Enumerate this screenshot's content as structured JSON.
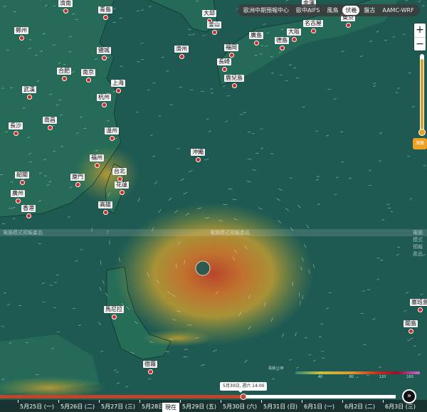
{
  "model_bar": {
    "items": [
      {
        "label": "歐洲中期預報中心",
        "active": false
      },
      {
        "label": "歐中AIFS",
        "active": false
      },
      {
        "label": "風鳥",
        "active": false
      },
      {
        "label": "伏羲",
        "active": true
      },
      {
        "label": "盤古",
        "active": false
      },
      {
        "label": "AAMC-WRF",
        "active": false
      }
    ]
  },
  "zoom": {
    "in_label": "+",
    "out_label": "−"
  },
  "layer_slider": {
    "label": "海面",
    "level_fraction": 0.95
  },
  "watermark": {
    "text": "電腦模式預報產品"
  },
  "legend": {
    "title": "風暴/小時",
    "ticks": [
      "40",
      "80",
      "120",
      "160"
    ]
  },
  "timeline": {
    "tooltip": "5月30日, 週六 14:00",
    "progress_fraction": 0.615,
    "days": [
      "5月25日 (一)",
      "5月26日 (二)",
      "5月27日 (三)",
      "5月28日 (四)",
      "5月29日 (五)",
      "5月30日 (六)",
      "5月31日 (日)",
      "6月1日 (一)",
      "6月2日 (二)",
      "6月3日 (三)"
    ],
    "now_label": "現在",
    "play_label": "»"
  },
  "cities": [
    {
      "name": "濟南"
    },
    {
      "name": "青島"
    },
    {
      "name": "大邱"
    },
    {
      "name": "金澤"
    },
    {
      "name": "東京"
    },
    {
      "name": "釜山"
    },
    {
      "name": "名古屋"
    },
    {
      "name": "鄭州"
    },
    {
      "name": "廣島"
    },
    {
      "name": "大阪"
    },
    {
      "name": "鹽城"
    },
    {
      "name": "濟州"
    },
    {
      "name": "福岡"
    },
    {
      "name": "德島"
    },
    {
      "name": "合肥"
    },
    {
      "name": "南京"
    },
    {
      "name": "長崎"
    },
    {
      "name": "上海"
    },
    {
      "name": "鹿兒島"
    },
    {
      "name": "武漢"
    },
    {
      "name": "杭州"
    },
    {
      "name": "長沙"
    },
    {
      "name": "南昌"
    },
    {
      "name": "溫州"
    },
    {
      "name": "沖繩"
    },
    {
      "name": "福州"
    },
    {
      "name": "台北"
    },
    {
      "name": "韶關"
    },
    {
      "name": "廈門"
    },
    {
      "name": "花蓮"
    },
    {
      "name": "廣州"
    },
    {
      "name": "香港"
    },
    {
      "name": "高雄"
    },
    {
      "name": "馬尼拉"
    },
    {
      "name": "塞班島"
    },
    {
      "name": "關島"
    },
    {
      "name": "宿霧"
    }
  ],
  "colors": {
    "ocean": "#1f5a52",
    "land": "#2c7a5d",
    "storm_core": "#c0442a",
    "storm_mid": "#d8a030",
    "marker": "#e02020",
    "accent": "#f0a020"
  }
}
